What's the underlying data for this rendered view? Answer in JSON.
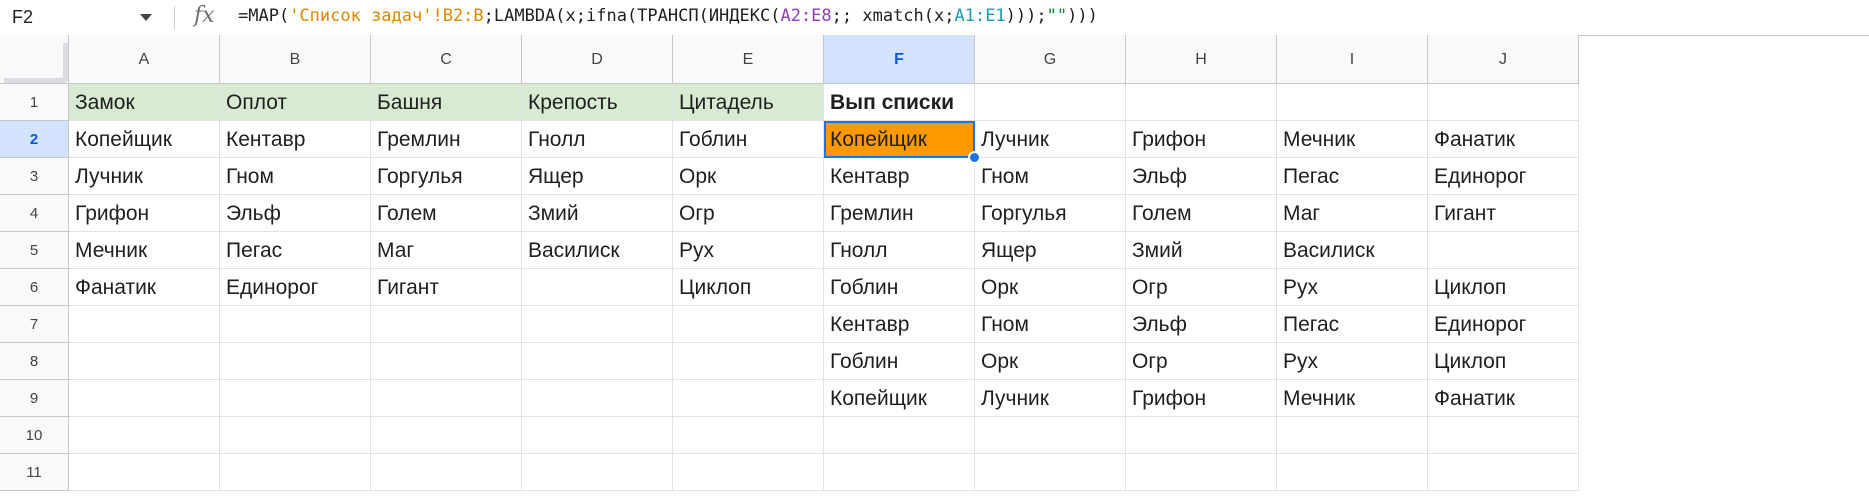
{
  "name_box": {
    "ref": "F2"
  },
  "formula_bar": {
    "fx": "fx",
    "segments": [
      {
        "text": "=MAP(",
        "color": "default"
      },
      {
        "text": "'Список задач'!B2:B",
        "color": "orange"
      },
      {
        "text": ";LAMBDA(x;ifna(ТРАНСП(ИНДЕКС(",
        "color": "default"
      },
      {
        "text": "A2:E8",
        "color": "purple"
      },
      {
        "text": ";; xmatch(x;",
        "color": "default"
      },
      {
        "text": "A1:E1",
        "color": "teal"
      },
      {
        "text": ")));",
        "color": "default"
      },
      {
        "text": "\"\"",
        "color": "green"
      },
      {
        "text": ")))",
        "color": "default"
      }
    ]
  },
  "columns": [
    "A",
    "B",
    "C",
    "D",
    "E",
    "F",
    "G",
    "H",
    "I",
    "J"
  ],
  "rows": [
    "1",
    "2",
    "3",
    "4",
    "5",
    "6",
    "7",
    "8",
    "9",
    "10",
    "11"
  ],
  "selected": {
    "column": "F",
    "row": "2"
  },
  "colors": {
    "header_fill": "#d9ead3",
    "active_fill": "#ff9900",
    "selection": "#1a73e8"
  },
  "cells": [
    [
      "Замок",
      "Оплот",
      "Башня",
      "Крепость",
      "Цитадель",
      "Вып списки",
      "",
      "",
      "",
      ""
    ],
    [
      "Копейщик",
      "Кентавр",
      "Гремлин",
      "Гнолл",
      "Гоблин",
      "Копейщик",
      "Лучник",
      "Грифон",
      "Мечник",
      "Фанатик"
    ],
    [
      "Лучник",
      "Гном",
      "Горгулья",
      "Ящер",
      "Орк",
      "Кентавр",
      "Гном",
      "Эльф",
      "Пегас",
      "Единорог"
    ],
    [
      "Грифон",
      "Эльф",
      "Голем",
      "Змий",
      "Огр",
      "Гремлин",
      "Горгулья",
      "Голем",
      "Маг",
      "Гигант"
    ],
    [
      "Мечник",
      "Пегас",
      "Маг",
      "Василиск",
      "Рух",
      "Гнолл",
      "Ящер",
      "Змий",
      "Василиск",
      ""
    ],
    [
      "Фанатик",
      "Единорог",
      "Гигант",
      "",
      "Циклоп",
      "Гоблин",
      "Орк",
      "Огр",
      "Рух",
      "Циклоп"
    ],
    [
      "",
      "",
      "",
      "",
      "",
      "Кентавр",
      "Гном",
      "Эльф",
      "Пегас",
      "Единорог"
    ],
    [
      "",
      "",
      "",
      "",
      "",
      "Гоблин",
      "Орк",
      "Огр",
      "Рух",
      "Циклоп"
    ],
    [
      "",
      "",
      "",
      "",
      "",
      "Копейщик",
      "Лучник",
      "Грифон",
      "Мечник",
      "Фанатик"
    ],
    [
      "",
      "",
      "",
      "",
      "",
      "",
      "",
      "",
      "",
      ""
    ],
    [
      "",
      "",
      "",
      "",
      "",
      "",
      "",
      "",
      "",
      ""
    ]
  ]
}
